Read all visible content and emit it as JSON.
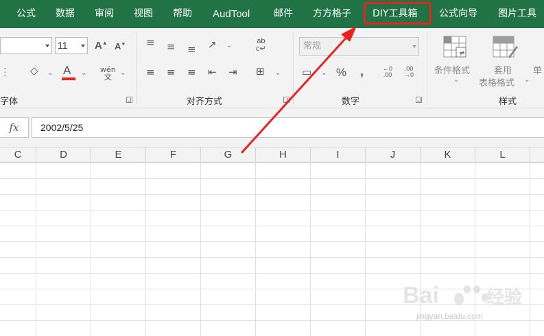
{
  "ribbon_tabs": [
    "公式",
    "数据",
    "审阅",
    "视图",
    "帮助",
    "AudTool",
    "邮件",
    "方方格子",
    "DIY工具箱",
    "公式向导",
    "图片工具"
  ],
  "font": {
    "size": "11",
    "color_accent": "#e8231f"
  },
  "groups": {
    "font": "字体",
    "alignment": "对齐方式",
    "number": "数字",
    "styles": "样式"
  },
  "number": {
    "format_value": "常规",
    "percent": "%",
    "comma": ",",
    "inc_decimal": "←0\n.00",
    "dec_decimal": ".00\n→0"
  },
  "styles": {
    "conditional_format": "条件格式",
    "table_format_line1": "套用",
    "table_format_line2": "表格格式",
    "cell_styles_partial": "单"
  },
  "formula_bar": {
    "fx": "fx",
    "value": "2002/5/25"
  },
  "columns": [
    "C",
    "D",
    "E",
    "F",
    "G",
    "H",
    "I",
    "J",
    "K",
    "L"
  ],
  "watermark": {
    "text": "jingyan.baidu.com"
  },
  "colors": {
    "ribbon_green": "#217346",
    "highlight_red": "#e8231f"
  }
}
